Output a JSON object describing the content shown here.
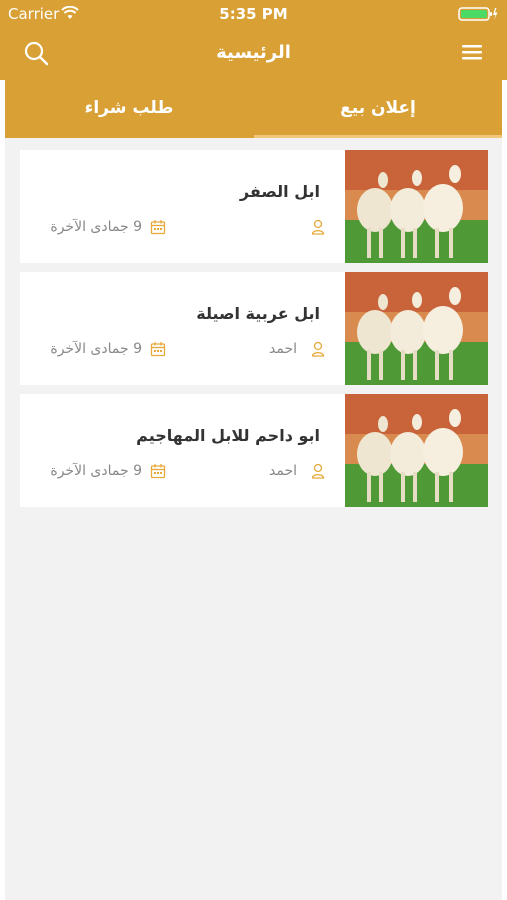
{
  "status_bar": {
    "carrier": "Carrier",
    "time": "5:35 PM"
  },
  "nav": {
    "title": "الرئيسية"
  },
  "tabs": [
    {
      "label": "طلب شراء",
      "active": false
    },
    {
      "label": "إعلان بيع",
      "active": true
    }
  ],
  "colors": {
    "brand": "#d9a035",
    "tab_indicator": "#f0c878",
    "background": "#f2f2f2",
    "icon_accent": "#e6a93a"
  },
  "listings": [
    {
      "title": "ابل الصفر",
      "user": "",
      "date": "9 جمادى الآخرة",
      "image": "camels-photo"
    },
    {
      "title": "ابل عربية اصيلة",
      "user": "احمد",
      "date": "9 جمادى الآخرة",
      "image": "camels-photo"
    },
    {
      "title": "ابو داحم للابل المهاجيم",
      "user": "احمد",
      "date": "9 جمادى الآخرة",
      "image": "camels-photo"
    }
  ]
}
